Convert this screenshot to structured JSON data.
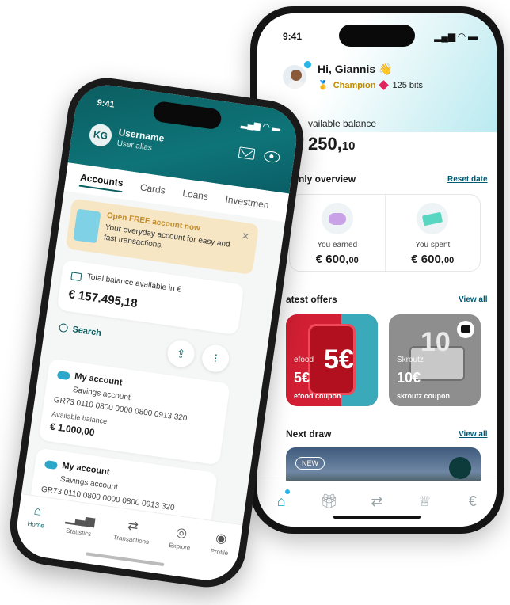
{
  "right_phone": {
    "status": {
      "time": "9:41",
      "signal": "▂▄▆",
      "wifi": "◠",
      "battery": "▬"
    },
    "greeting": "Hi, Giannis 👋",
    "level": "Champion",
    "bits": "125 bits",
    "balance_label": "Available balance",
    "balance_label_visible": "vailable balance",
    "balance_main": "250,",
    "balance_cents": "10",
    "overview_label": "nly overview",
    "reset_date": "Reset date",
    "earned_label": "You earned",
    "earned_amount": "€ 600,",
    "earned_cents": "00",
    "spent_label": "You spent",
    "spent_amount": "€ 600,",
    "spent_cents": "00",
    "offers_label": "atest offers",
    "view_all_offers": "View all",
    "offers": [
      {
        "brand": "efood",
        "value": "5€",
        "coupon": "efood coupon",
        "big": "5€"
      },
      {
        "brand": "Skroutz",
        "value": "10€",
        "coupon": "skroutz coupon",
        "big": "10"
      }
    ],
    "next_draw_label": "Next draw",
    "view_all_draw": "View all",
    "draw_badge": "NEW",
    "nav_icons": [
      "home-icon",
      "gift-icon",
      "transfer-icon",
      "trophy-icon",
      "euro-icon"
    ]
  },
  "left_phone": {
    "status": {
      "time": "9:41"
    },
    "initials": "KG",
    "username": "Username",
    "alias": "User alias",
    "tabs": [
      "Accounts",
      "Cards",
      "Loans",
      "Investmen"
    ],
    "promo_title": "Open FREE account now",
    "promo_text": "Your everyday account for easy and fast transactions.",
    "total_label": "Total balance available in €",
    "total_amount": "€ 157.495,18",
    "search_label": "Search",
    "accounts": [
      {
        "name": "My account",
        "type": "Savings account",
        "iban": "GR73 0110 0800 0000 0800 0913 320",
        "avail_label": "Available balance",
        "avail": "€ 1.000,00"
      },
      {
        "name": "My account",
        "type": "Savings account",
        "iban": "GR73 0110 0800 0000 0800 0913 320",
        "avail_label": "",
        "avail": ""
      }
    ],
    "nav": [
      "Home",
      "Statistics",
      "Transactions",
      "Explore",
      "Profile"
    ]
  },
  "colors": {
    "teal": "#0b5d60",
    "accent": "#0aa0b8",
    "link": "#005a73",
    "champion": "#c08a00",
    "gem": "#e0245e"
  }
}
